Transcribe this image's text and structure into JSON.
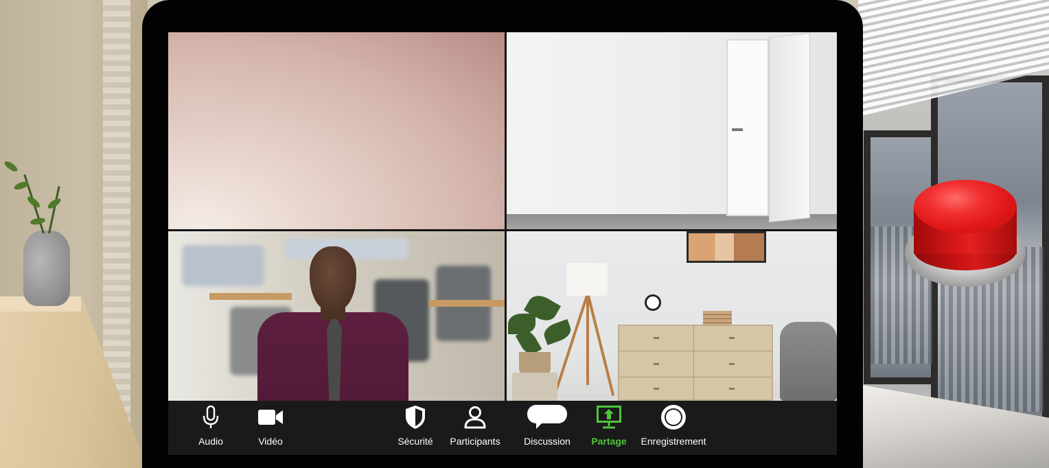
{
  "toolbar": {
    "items": [
      {
        "id": "audio",
        "label": "Audio",
        "icon": "microphone-icon"
      },
      {
        "id": "video",
        "label": "Vidéo",
        "icon": "video-camera-icon"
      },
      {
        "id": "security",
        "label": "Sécurité",
        "icon": "shield-icon"
      },
      {
        "id": "participants",
        "label": "Participants",
        "icon": "person-icon"
      },
      {
        "id": "chat",
        "label": "Discussion",
        "icon": "speech-bubble-icon"
      },
      {
        "id": "share",
        "label": "Partage",
        "icon": "share-screen-icon",
        "active": true
      },
      {
        "id": "record",
        "label": "Enregistrement",
        "icon": "record-icon"
      }
    ],
    "active_color": "#4fc63b",
    "background": "#1a1a1a"
  },
  "video_tiles": [
    {
      "id": "tile-1",
      "scene": "blurred-pink-background"
    },
    {
      "id": "tile-2",
      "scene": "white-room-open-door"
    },
    {
      "id": "tile-3",
      "scene": "office-with-avatar"
    },
    {
      "id": "tile-4",
      "scene": "living-room-dresser"
    }
  ],
  "big_button": {
    "color": "#e01818"
  }
}
